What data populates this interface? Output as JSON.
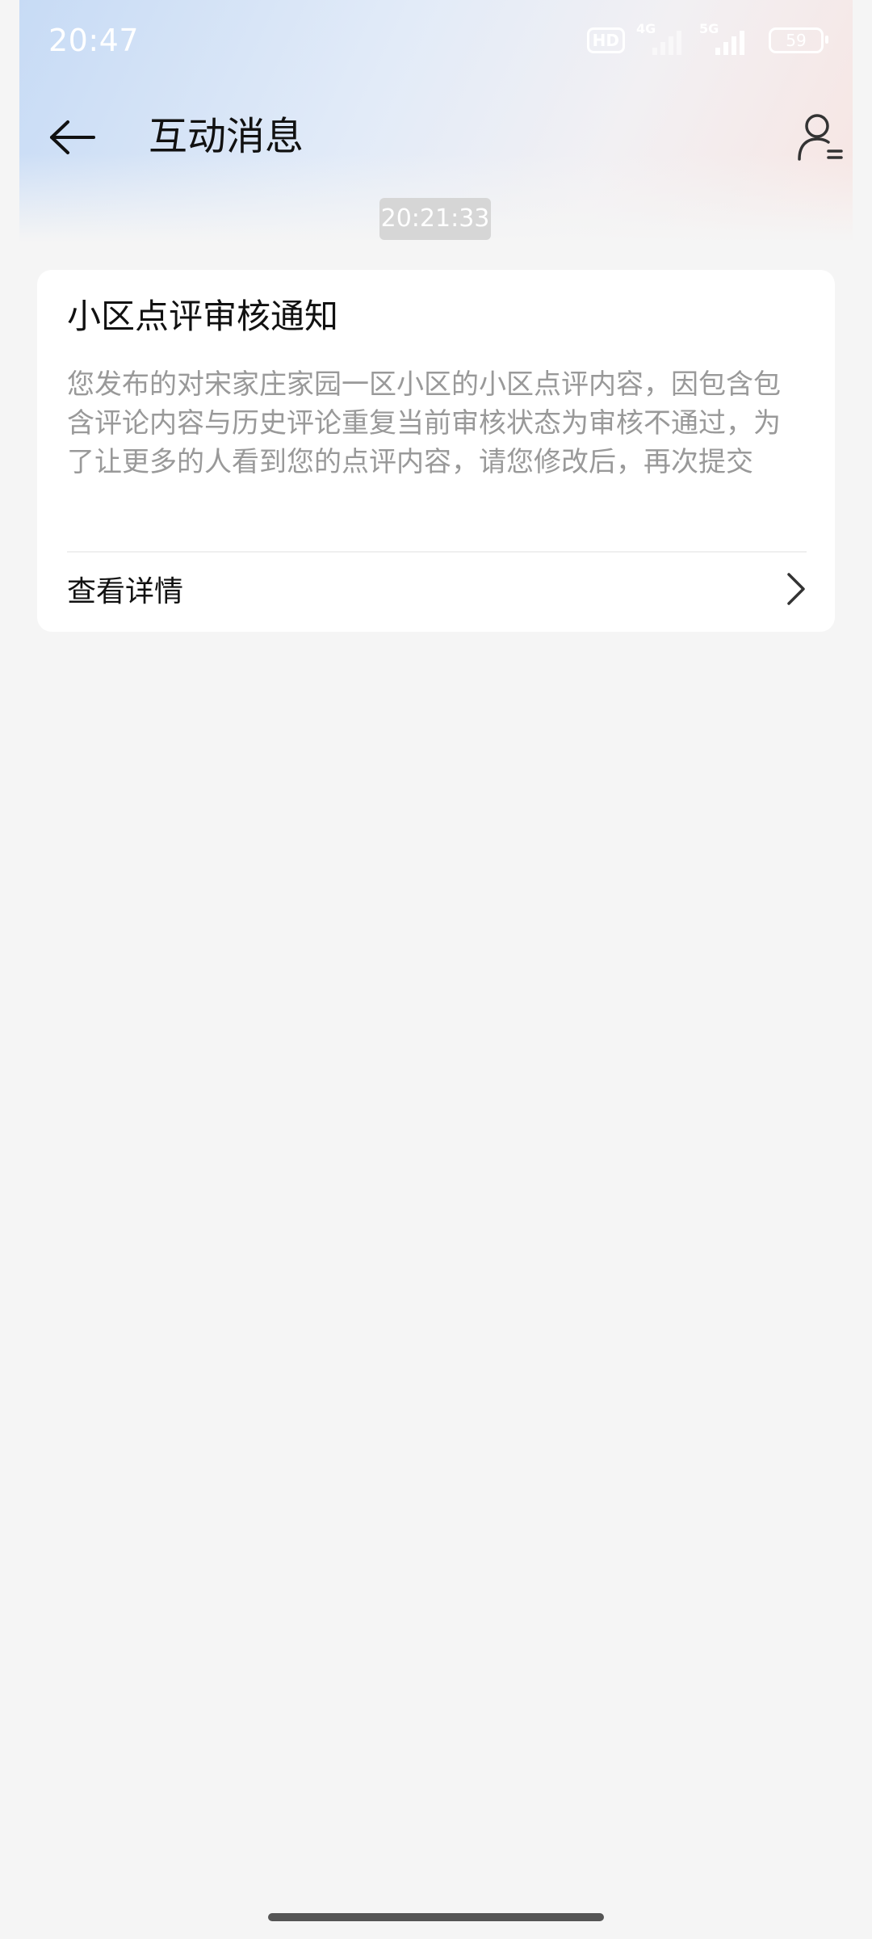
{
  "status_bar": {
    "time": "20:47",
    "hd_label": "HD",
    "network_1": "4G",
    "network_2": "5G",
    "battery": "59"
  },
  "header": {
    "title": "互动消息",
    "back_icon": "arrow-left-icon",
    "profile_icon": "user-list-icon"
  },
  "timestamp": "20:21:33",
  "notice": {
    "title": "小区点评审核通知",
    "body": "您发布的对宋家庄家园一区小区的小区点评内容，因包含包含评论内容与历史评论重复当前审核状态为审核不通过，为了让更多的人看到您的点评内容，请您修改后，再次提交",
    "detail_label": "查看详情",
    "detail_icon": "chevron-right-icon"
  },
  "colors": {
    "background": "#f5f5f5",
    "card": "#ffffff",
    "body_text": "#999999",
    "timestamp_bg": "#d6d6d6"
  }
}
